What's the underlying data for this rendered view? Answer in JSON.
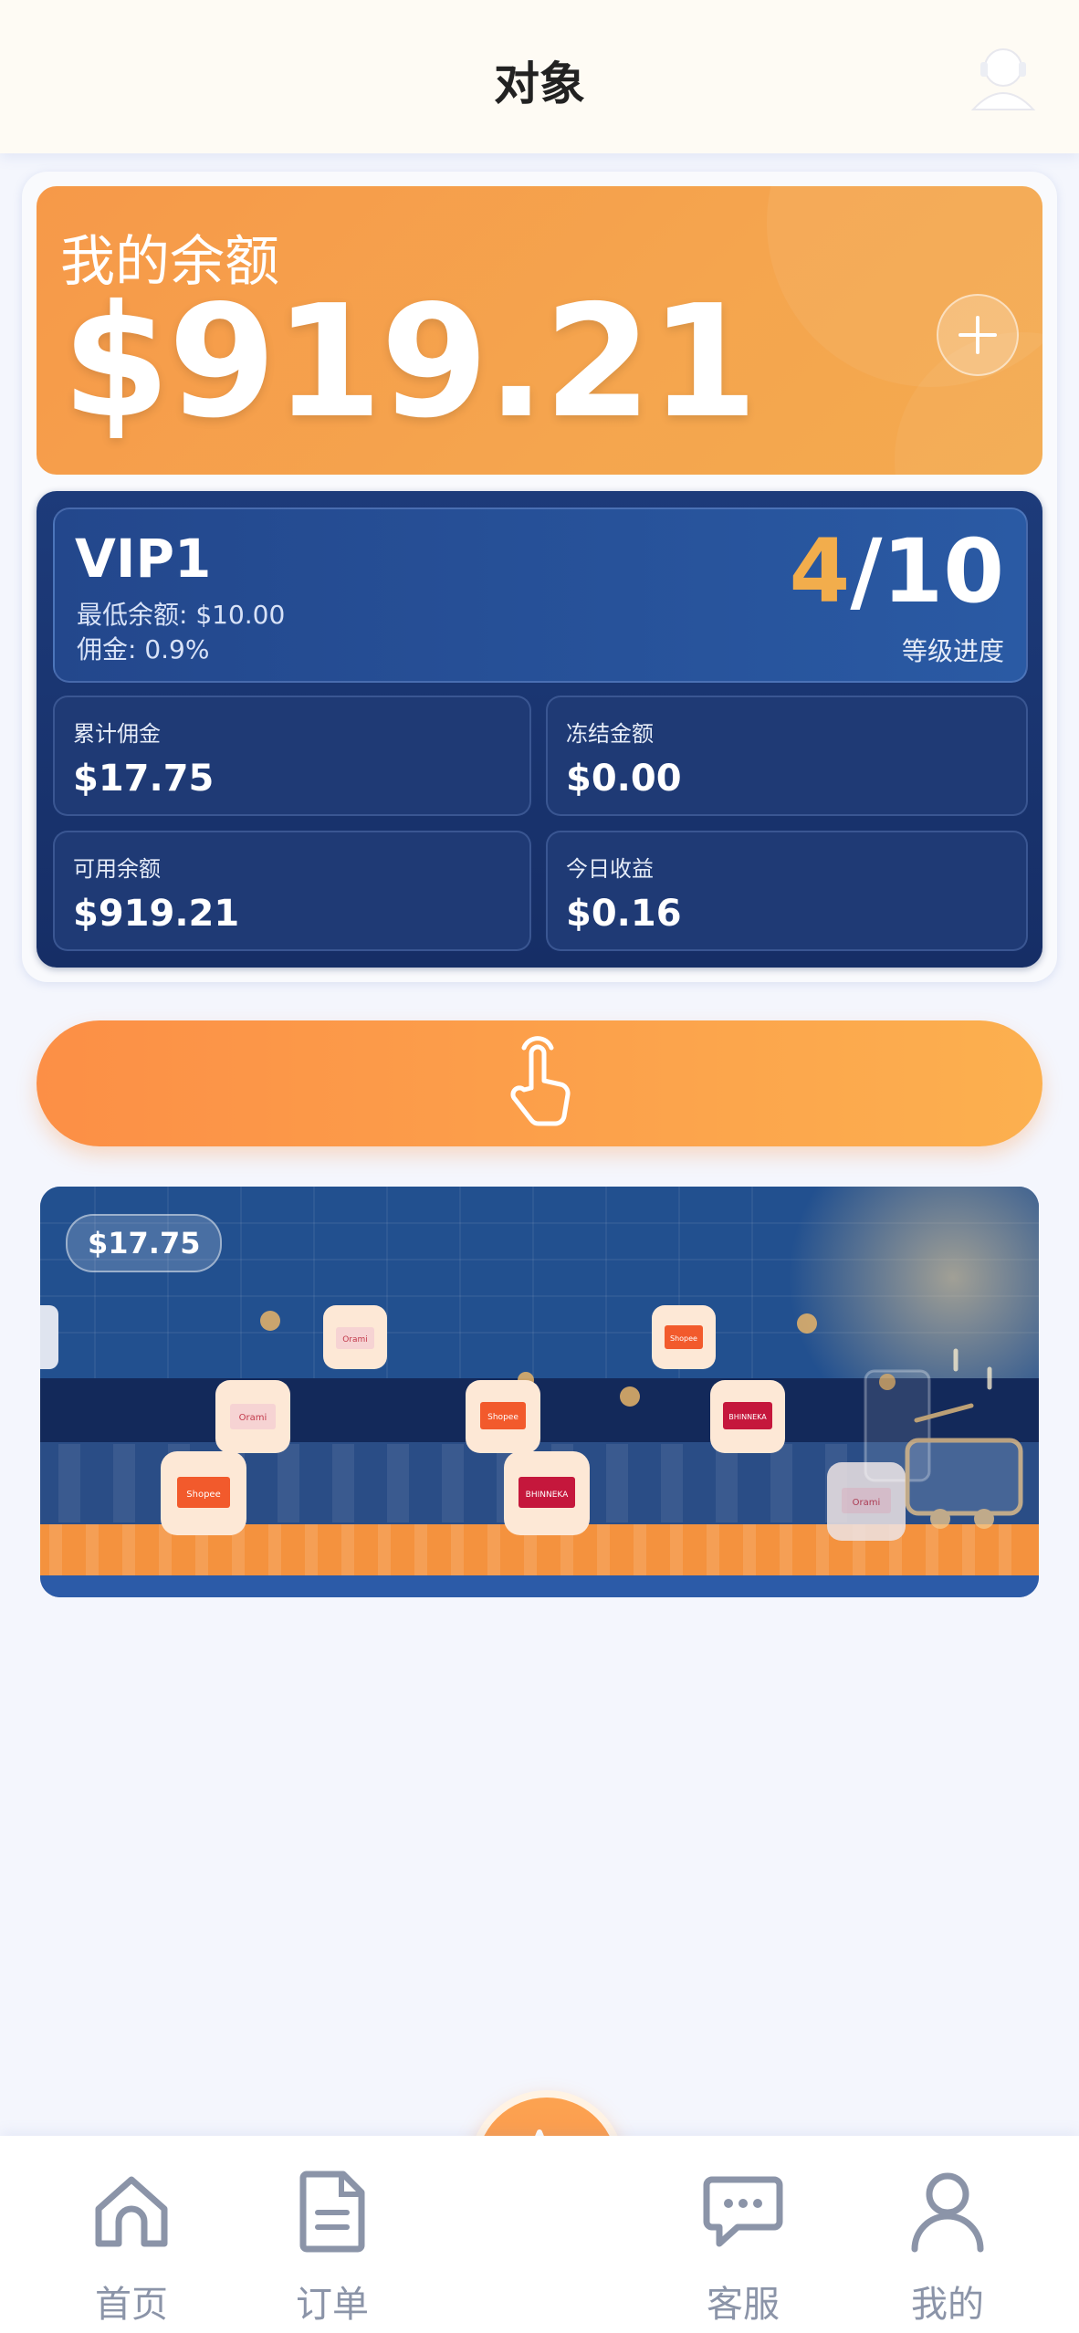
{
  "header": {
    "title": "对象",
    "support_icon": "agent-avatar-icon"
  },
  "balance": {
    "label": "我的余额",
    "amount": "$919.21",
    "add_icon": "plus-icon"
  },
  "vip": {
    "level": "VIP1",
    "min_balance": "最低余额: $10.00",
    "commission_rate": "佣金: 0.9%",
    "progress_current": "4",
    "progress_total": "/10",
    "progress_value": 0.4,
    "progress_label": "等级进度"
  },
  "stats": [
    {
      "label": "累计佣金",
      "value": "$17.75"
    },
    {
      "label": "冻结金额",
      "value": "$0.00"
    },
    {
      "label": "可用余额",
      "value": "$919.21"
    },
    {
      "label": "今日收益",
      "value": "$0.16"
    }
  ],
  "action_button": {
    "icon": "hand-tap-icon"
  },
  "scene": {
    "amount": "$17.75",
    "product_logos": [
      "Orami",
      "Shopee",
      "BHINNEKA"
    ]
  },
  "colors": {
    "accent": "#fc9a4b",
    "navy": "#1d3b7a",
    "gold": "#f2ad4c"
  },
  "nav": {
    "items": [
      {
        "label": "首页",
        "icon": "home-icon"
      },
      {
        "label": "订单",
        "icon": "document-icon"
      },
      {
        "label": "",
        "icon": "star-icon"
      },
      {
        "label": "客服",
        "icon": "chat-icon"
      },
      {
        "label": "我的",
        "icon": "user-icon"
      }
    ]
  }
}
